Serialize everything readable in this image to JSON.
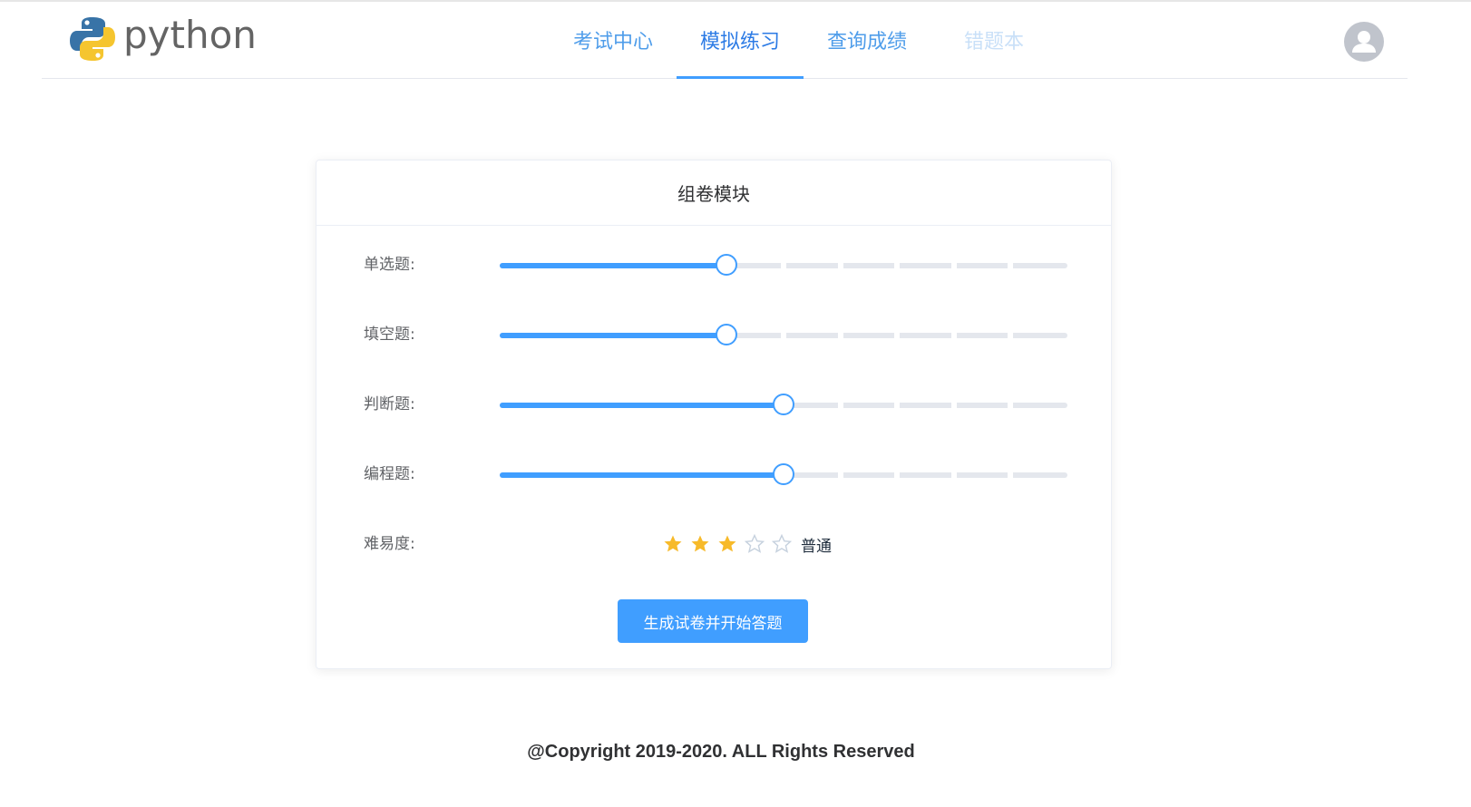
{
  "header": {
    "logo_text": "python",
    "nav": [
      {
        "label": "考试中心",
        "state": "normal"
      },
      {
        "label": "模拟练习",
        "state": "active"
      },
      {
        "label": "查询成绩",
        "state": "normal"
      },
      {
        "label": "错题本",
        "state": "disabled"
      }
    ],
    "avatar_icon": "user-avatar-icon"
  },
  "card": {
    "title": "组卷模块",
    "sliders": [
      {
        "label": "单选题:",
        "value_fraction": 0.4,
        "steps": 10
      },
      {
        "label": "填空题:",
        "value_fraction": 0.4,
        "steps": 10
      },
      {
        "label": "判断题:",
        "value_fraction": 0.5,
        "steps": 10
      },
      {
        "label": "编程题:",
        "value_fraction": 0.5,
        "steps": 10
      }
    ],
    "difficulty": {
      "label": "难易度:",
      "rating": 3,
      "max": 5,
      "text": "普通"
    },
    "submit_label": "生成试卷并开始答题"
  },
  "footer": {
    "copyright": "@Copyright 2019-2020. ALL Rights Reserved"
  },
  "colors": {
    "primary": "#409eff",
    "star_on": "#f7ba2a",
    "star_off": "#c6d1de",
    "track": "#e4e7ed"
  }
}
